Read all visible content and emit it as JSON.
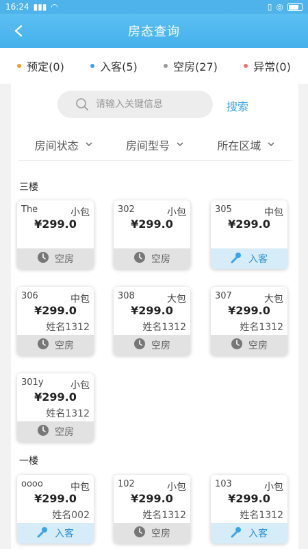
{
  "statusbar": {
    "time": "16:24"
  },
  "header": {
    "title": "房态查询"
  },
  "legend": [
    {
      "label": "预定(0)",
      "color": "#f0a020"
    },
    {
      "label": "入客(5)",
      "color": "#3aa4e6"
    },
    {
      "label": "空房(27)",
      "color": "#999999"
    },
    {
      "label": "异常(0)",
      "color": "#f07070"
    }
  ],
  "search": {
    "placeholder": "请输入关键信息",
    "button": "搜索"
  },
  "filters": [
    "房间状态",
    "房间型号",
    "所在区域"
  ],
  "sections": [
    {
      "title": "三楼",
      "rooms": [
        {
          "num": "The",
          "type": "小包",
          "price": "¥299.0",
          "guest": "",
          "status": "空房",
          "state": "empty"
        },
        {
          "num": "302",
          "type": "小包",
          "price": "¥299.0",
          "guest": "",
          "status": "空房",
          "state": "empty"
        },
        {
          "num": "305",
          "type": "中包",
          "price": "¥299.0",
          "guest": "",
          "status": "入客",
          "state": "in"
        },
        {
          "num": "306",
          "type": "中包",
          "price": "¥299.0",
          "guest": "姓名1312",
          "status": "空房",
          "state": "empty"
        },
        {
          "num": "308",
          "type": "大包",
          "price": "¥299.0",
          "guest": "姓名1312",
          "status": "空房",
          "state": "empty"
        },
        {
          "num": "307",
          "type": "大包",
          "price": "¥299.0",
          "guest": "姓名1312",
          "status": "空房",
          "state": "empty"
        },
        {
          "num": "301y",
          "type": "小包",
          "price": "¥299.0",
          "guest": "姓名1312",
          "status": "空房",
          "state": "empty"
        }
      ]
    },
    {
      "title": "一楼",
      "rooms": [
        {
          "num": "oooo",
          "type": "中包",
          "price": "¥299.0",
          "guest": "姓名002",
          "status": "入客",
          "state": "in"
        },
        {
          "num": "102",
          "type": "小包",
          "price": "¥299.0",
          "guest": "姓名1312",
          "status": "空房",
          "state": "empty"
        },
        {
          "num": "103",
          "type": "小包",
          "price": "¥299.0",
          "guest": "姓名1312",
          "status": "入客",
          "state": "in"
        }
      ]
    }
  ]
}
